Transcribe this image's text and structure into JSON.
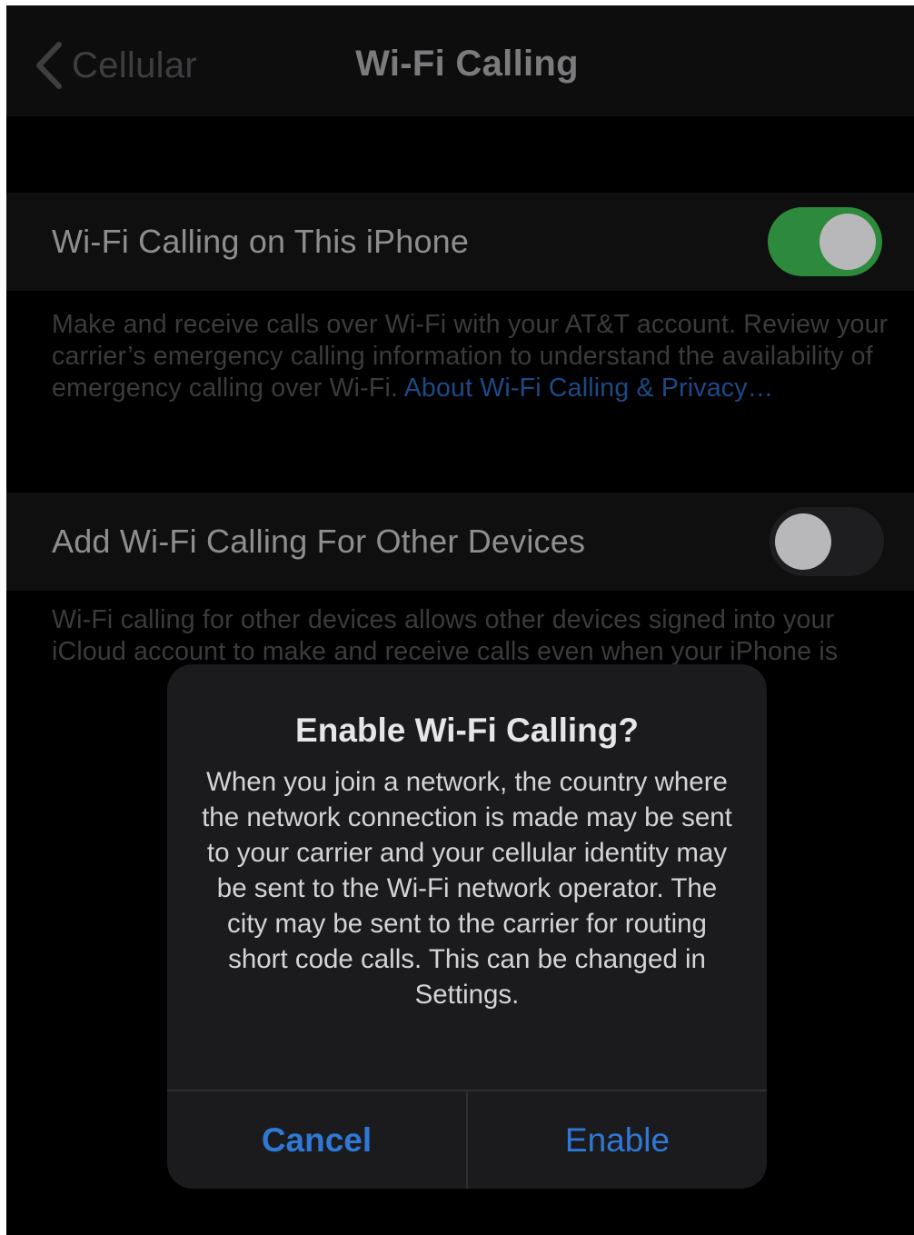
{
  "navbar": {
    "back_label": "Cellular",
    "title": "Wi-Fi Calling"
  },
  "settings": {
    "wifi_calling": {
      "label": "Wi-Fi Calling on This iPhone",
      "enabled": true,
      "footer": "Make and receive calls over Wi-Fi with your AT&T account. Review your carrier’s emergency calling information to understand the availability of emergency calling over Wi-Fi. ",
      "footer_link": "About Wi-Fi Calling & Privacy…"
    },
    "other_devices": {
      "label": "Add Wi-Fi Calling For Other Devices",
      "enabled": false,
      "footer_visible": "Wi-Fi calling for other devices allows other devices signed into your iCloud account to make and receive calls even when your iPhone is"
    }
  },
  "alert": {
    "title": "Enable Wi-Fi Calling?",
    "message": "When you join a network, the country where the network connection is made may be sent to your carrier and your cellular identity may be sent to the Wi-Fi network operator. The city may be sent to the carrier for routing short code calls. This can be changed in Settings.",
    "cancel_label": "Cancel",
    "enable_label": "Enable"
  },
  "colors": {
    "toggle_on": "#2d8a3c",
    "link": "#1c4a87",
    "alert_button": "#2f78d6"
  }
}
